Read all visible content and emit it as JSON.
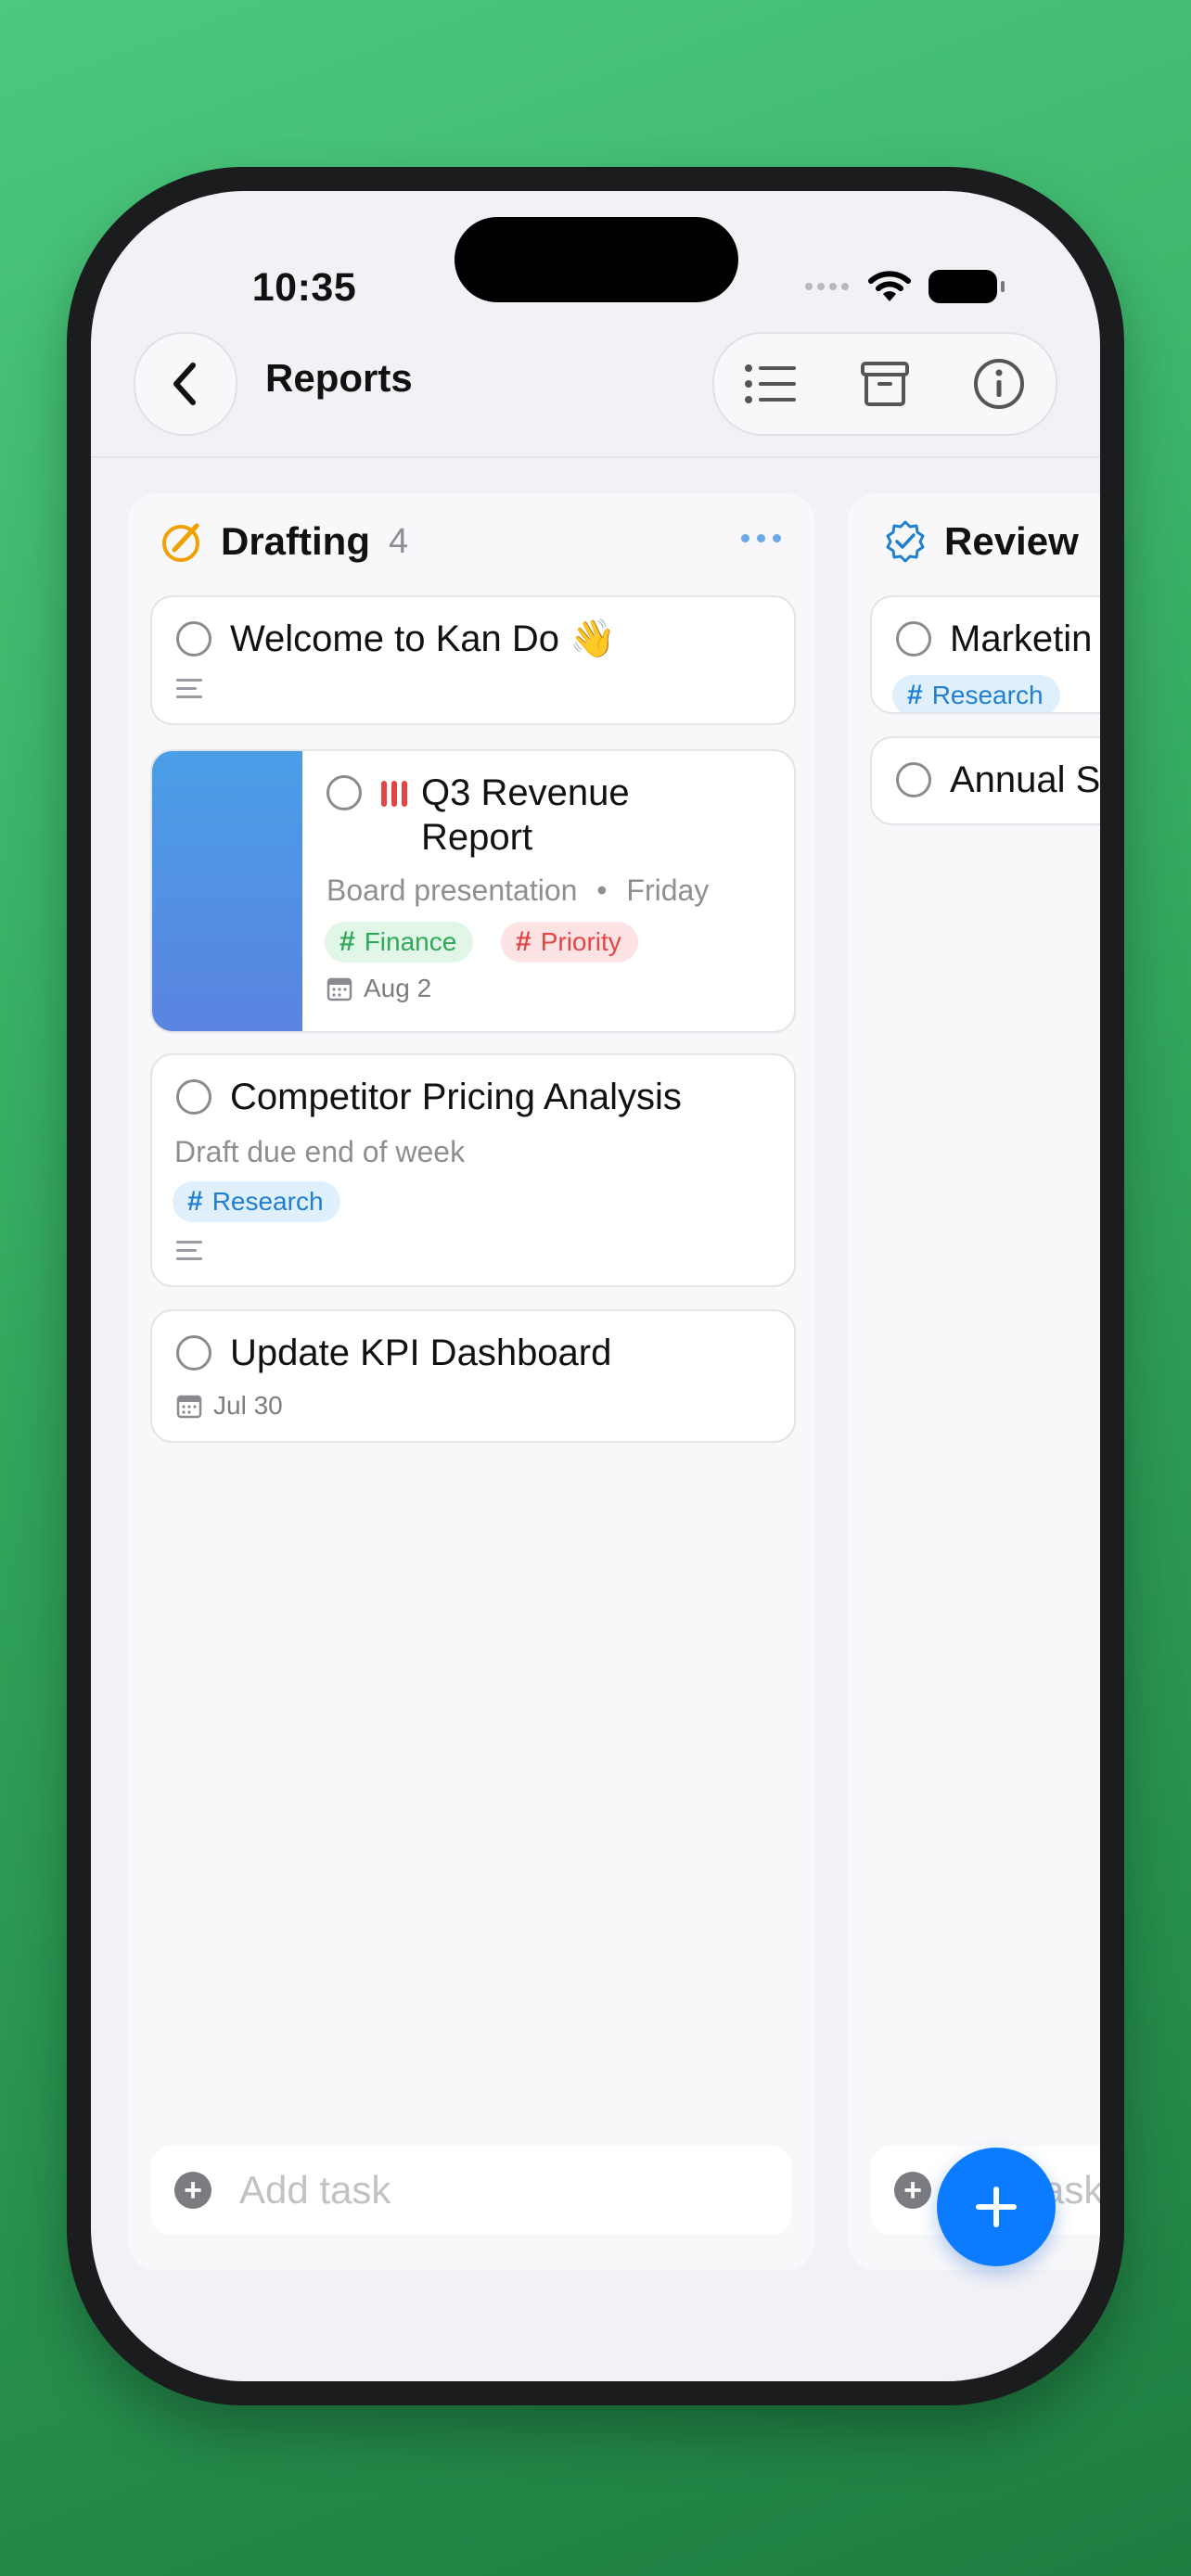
{
  "status_bar": {
    "time": "10:35"
  },
  "nav": {
    "title": "Reports",
    "back_icon": "chevron-left-icon",
    "actions": [
      "list-icon",
      "archive-icon",
      "info-icon"
    ]
  },
  "columns": [
    {
      "title": "Drafting",
      "count": "4",
      "icon": "pencil-circle-icon",
      "accent": "#f0a000",
      "cards": [
        {
          "title": "Welcome to Kan Do 👋",
          "has_notes": true
        },
        {
          "title_line1": "Q3 Revenue",
          "title_line2": "Report",
          "subtitle": "Board presentation",
          "due": "Friday",
          "tags": [
            "Finance",
            "Priority"
          ],
          "date": "Aug 2",
          "priority_icon": "priority-high-icon",
          "cover_color": "#4a90e2"
        },
        {
          "title": "Competitor Pricing Analysis",
          "subtitle": "Draft due end of week",
          "tags": [
            "Research"
          ],
          "has_notes": true
        },
        {
          "title": "Update KPI Dashboard",
          "date": "Jul 30"
        }
      ],
      "add_label": "Add task"
    },
    {
      "title": "Review",
      "icon": "checkmark-seal-icon",
      "accent": "#1f7fd1",
      "cards": [
        {
          "title": "Marketin",
          "tags": [
            "Research"
          ]
        },
        {
          "title": "Annual S"
        }
      ],
      "add_label": "ask"
    }
  ],
  "fab": {
    "icon": "plus-icon"
  },
  "colors": {
    "brand": "#0b7bff",
    "finance": "#2fa857",
    "priority": "#e24545",
    "research": "#1f7fd1"
  }
}
